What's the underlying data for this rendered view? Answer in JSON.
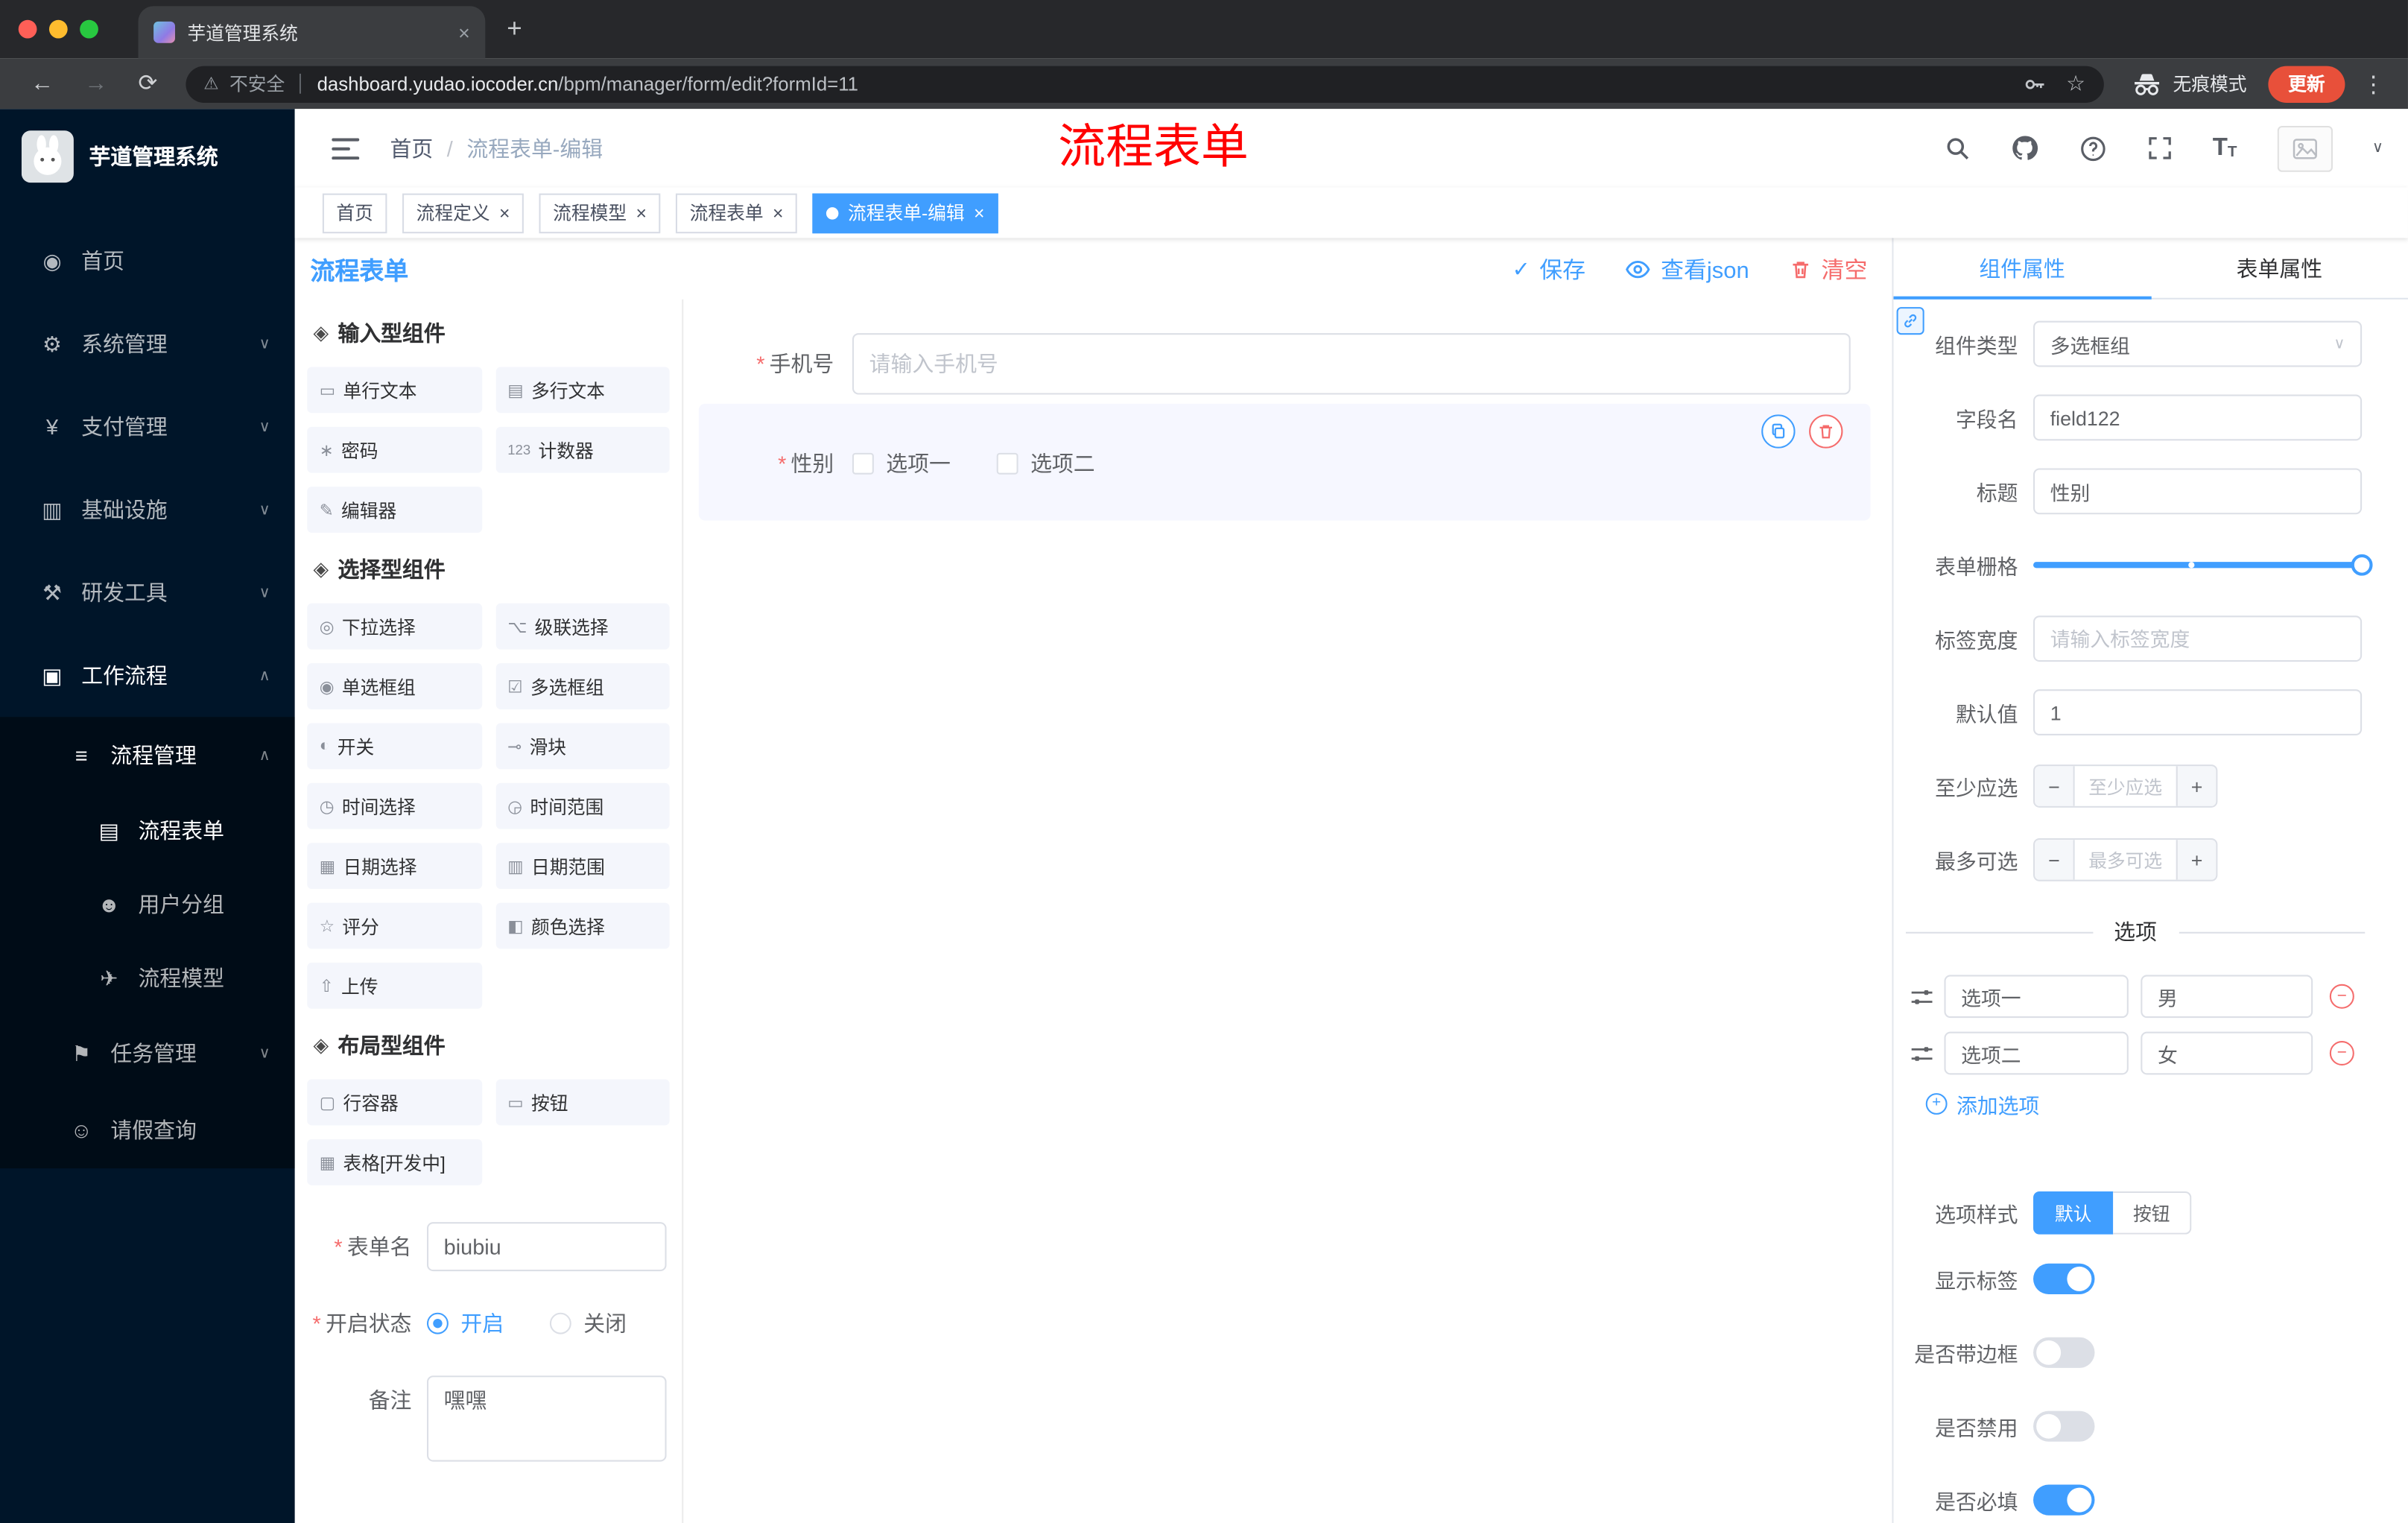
{
  "browser": {
    "tab_title": "芋道管理系统",
    "security_label": "不安全",
    "url_domain": "dashboard.yudao.iocoder.cn",
    "url_path": "/bpm/manager/form/edit?formId=11",
    "incognito_label": "无痕模式",
    "update_label": "更新"
  },
  "sidebar": {
    "logo_title": "芋道管理系统",
    "items": [
      {
        "label": "首页",
        "glyph": "◉"
      },
      {
        "label": "系统管理",
        "glyph": "⚙",
        "arrow": "∨"
      },
      {
        "label": "支付管理",
        "glyph": "¥",
        "arrow": "∨"
      },
      {
        "label": "基础设施",
        "glyph": "▥",
        "arrow": "∨"
      },
      {
        "label": "研发工具",
        "glyph": "⚒",
        "arrow": "∨"
      },
      {
        "label": "工作流程",
        "glyph": "▣",
        "arrow": "∧"
      },
      {
        "label": "流程管理",
        "glyph": "≡",
        "arrow": "∧"
      },
      {
        "label": "流程表单",
        "glyph": "▤"
      },
      {
        "label": "用户分组",
        "glyph": "☻"
      },
      {
        "label": "流程模型",
        "glyph": "✈"
      },
      {
        "label": "任务管理",
        "glyph": "⚑",
        "arrow": "∨"
      },
      {
        "label": "请假查询",
        "glyph": "☺"
      }
    ]
  },
  "header": {
    "breadcrumb_home": "首页",
    "breadcrumb_sep": "/",
    "breadcrumb_current": "流程表单-编辑",
    "annotation": "流程表单"
  },
  "tags": [
    {
      "label": "首页"
    },
    {
      "label": "流程定义"
    },
    {
      "label": "流程模型"
    },
    {
      "label": "流程表单"
    },
    {
      "label": "流程表单-编辑"
    }
  ],
  "designer": {
    "title": "流程表单",
    "save": "保存",
    "view_json": "查看json",
    "clear": "清空",
    "palette": {
      "groups": [
        {
          "title": "输入型组件",
          "items": [
            {
              "label": "单行文本",
              "glyph": "▭"
            },
            {
              "label": "多行文本",
              "glyph": "▤"
            },
            {
              "label": "密码",
              "glyph": "∗"
            },
            {
              "label": "计数器",
              "glyph": "123"
            },
            {
              "label": "编辑器",
              "glyph": "✎"
            }
          ]
        },
        {
          "title": "选择型组件",
          "items": [
            {
              "label": "下拉选择",
              "glyph": "◎"
            },
            {
              "label": "级联选择",
              "glyph": "⌥"
            },
            {
              "label": "单选框组",
              "glyph": "◉"
            },
            {
              "label": "多选框组",
              "glyph": "☑"
            },
            {
              "label": "开关",
              "glyph": "◐"
            },
            {
              "label": "滑块",
              "glyph": "⊸"
            },
            {
              "label": "时间选择",
              "glyph": "◷"
            },
            {
              "label": "时间范围",
              "glyph": "◶"
            },
            {
              "label": "日期选择",
              "glyph": "▦"
            },
            {
              "label": "日期范围",
              "glyph": "▥"
            },
            {
              "label": "评分",
              "glyph": "☆"
            },
            {
              "label": "颜色选择",
              "glyph": "◧"
            },
            {
              "label": "上传",
              "glyph": "⇧"
            }
          ]
        },
        {
          "title": "布局型组件",
          "items": [
            {
              "label": "行容器",
              "glyph": "▢"
            },
            {
              "label": "按钮",
              "glyph": "▭"
            },
            {
              "label": "表格[开发中]",
              "glyph": "▦"
            }
          ]
        }
      ]
    },
    "meta": {
      "form_name_label": "表单名",
      "form_name_value": "biubiu",
      "status_label": "开启状态",
      "status_on": "开启",
      "status_off": "关闭",
      "remark_label": "备注",
      "remark_value": "嘿嘿"
    },
    "canvas": {
      "phone_label": "手机号",
      "phone_placeholder": "请输入手机号",
      "gender_label": "性别",
      "option1": "选项一",
      "option2": "选项二"
    }
  },
  "props": {
    "tab_component": "组件属性",
    "tab_form": "表单属性",
    "component_type_label": "组件类型",
    "component_type_value": "多选框组",
    "field_name_label": "字段名",
    "field_name_value": "field122",
    "title_label": "标题",
    "title_value": "性别",
    "grid_label": "表单栅格",
    "label_width_label": "标签宽度",
    "label_width_placeholder": "请输入标签宽度",
    "default_label": "默认值",
    "default_value": "1",
    "min_label": "至少应选",
    "min_placeholder": "至少应选",
    "max_label": "最多可选",
    "max_placeholder": "最多可选",
    "options_title": "选项",
    "options": [
      {
        "name": "选项一",
        "value": "男"
      },
      {
        "name": "选项二",
        "value": "女"
      }
    ],
    "add_option": "添加选项",
    "style_label": "选项样式",
    "style_default": "默认",
    "style_button": "按钮",
    "switch_show_label": "显示标签",
    "switch_border": "是否带边框",
    "switch_disabled": "是否禁用",
    "switch_required": "是否必填"
  },
  "glyphs": {
    "close": "×",
    "plus": "+",
    "minus": "−",
    "caret_down": "∨",
    "required": "*",
    "group": "◈",
    "check": "✓",
    "back": "←",
    "forward": "→",
    "reload": "⟳",
    "kebab": "⋮",
    "star": "☆",
    "warning": "⚠",
    "text_icon": "T"
  }
}
